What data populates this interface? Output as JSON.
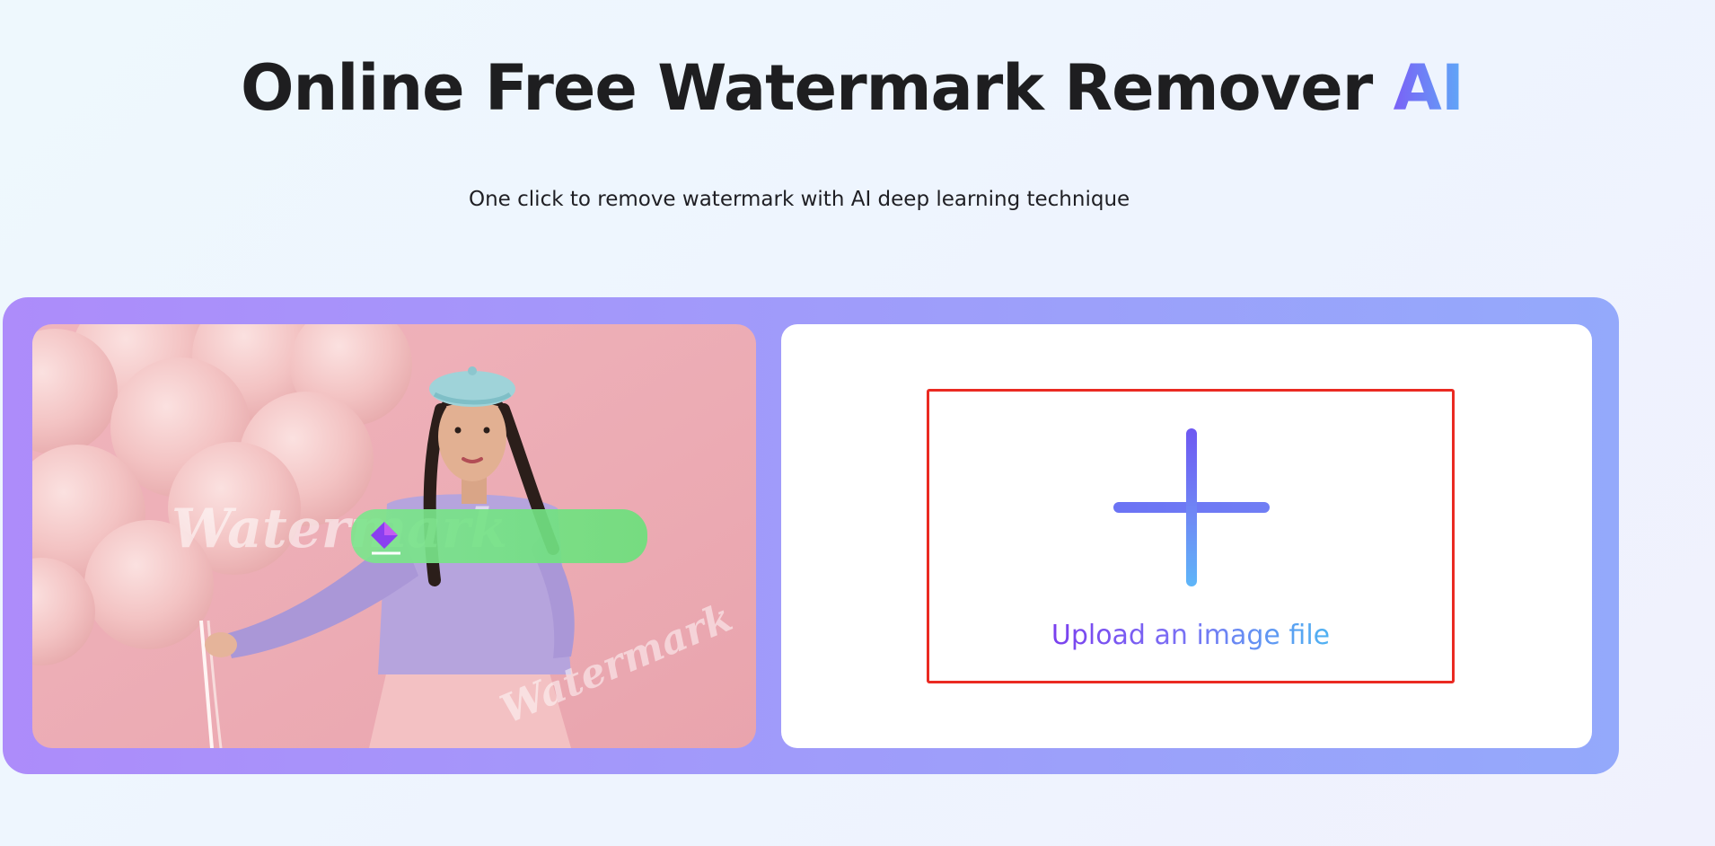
{
  "hero": {
    "title": "Online Free Watermark Remover ",
    "title_accent": "AI",
    "subtitle": "One click to remove watermark with AI deep learning technique"
  },
  "demo_image": {
    "watermark_text_1": "Watermark",
    "watermark_text_2": "Watermark",
    "eraser_icon": "eraser-icon"
  },
  "upload": {
    "icon": "plus-icon",
    "label": "Upload an image file"
  },
  "colors": {
    "title_text": "#1e1e20",
    "accent_gradient_start": "#7a61f6",
    "accent_gradient_end": "#5fa9f7",
    "panel_gradient_start": "#ad8cfa",
    "panel_gradient_end": "#94a9fb",
    "upload_box_border": "#ea2a22",
    "upload_label_gradient_start": "#7a3fee",
    "upload_label_gradient_end": "#4fb2f2"
  }
}
